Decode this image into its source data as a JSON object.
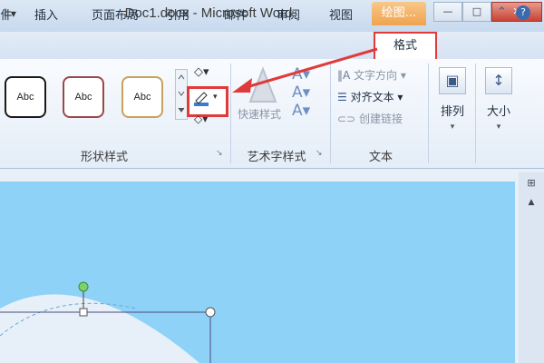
{
  "titlebar": {
    "quick_access": "| ▾",
    "window_title": "Doc1.docx - Microsoft Word",
    "context_tab": "绘图...",
    "minimize_glyph": "—",
    "maximize_glyph": "□",
    "close_glyph": "✕"
  },
  "tabs": [
    "件",
    "插入",
    "页面布局",
    "引用",
    "邮件",
    "审阅",
    "视图",
    "格式"
  ],
  "active_tab": "格式",
  "ribbon_icons": {
    "collapse_glyph": "⌃",
    "help_glyph": "?"
  },
  "shape_styles": {
    "items": [
      "Abc",
      "Abc",
      "Abc"
    ],
    "colors": [
      "#1a1a1a",
      "#9c4747",
      "#c7a25a"
    ],
    "group_label": "形状样式",
    "fill_glyph": "◇▾",
    "effects_glyph": "◇▾"
  },
  "wordart": {
    "quick_styles_label": "快速样式",
    "group_label": "艺术字样式",
    "icons": [
      "A▾",
      "A▾",
      "A▾"
    ]
  },
  "text_group": {
    "text_direction": "文字方向 ▾",
    "align_text": "对齐文本 ▾",
    "create_link": "创建链接",
    "group_label": "文本"
  },
  "arrange": {
    "label": "排列"
  },
  "size": {
    "label": "大小"
  },
  "launcher_glyph": "↘",
  "colors": {
    "highlight_red": "#e03a3a",
    "canvas_blue": "#8fd2f7",
    "context_orange": "#f0a24d"
  }
}
